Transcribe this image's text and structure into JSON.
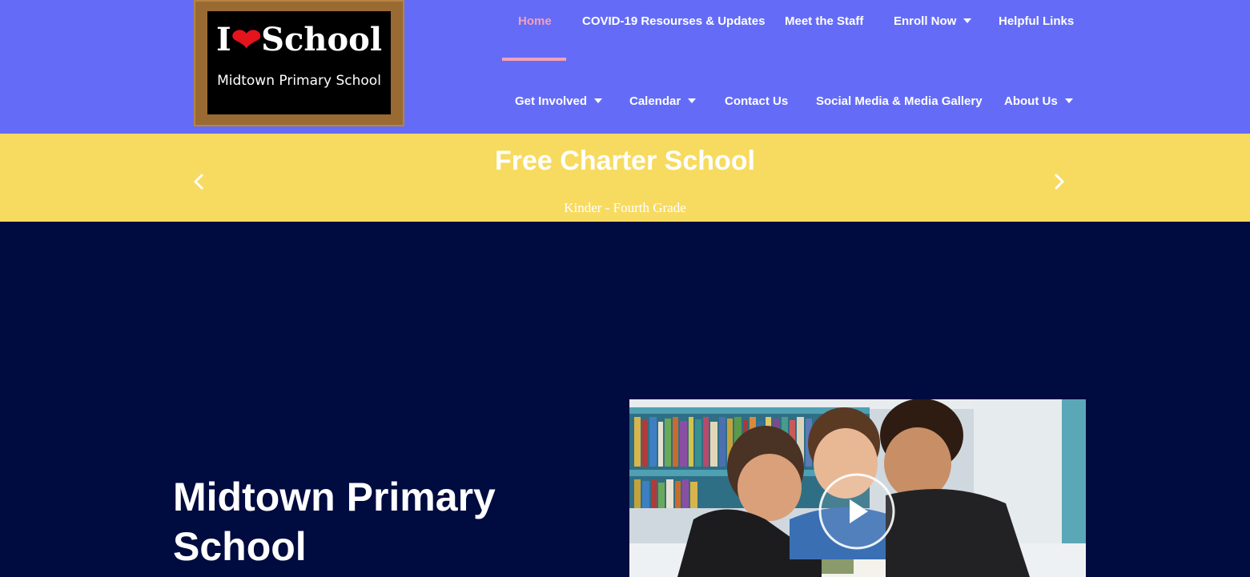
{
  "logo": {
    "line1_a": "I",
    "line1_b": "School",
    "line2": "Midtown Primary School"
  },
  "nav": {
    "row1": [
      {
        "label": "Home",
        "active": true,
        "dropdown": false
      },
      {
        "label": "COVID-19 Resourses & Updates",
        "active": false,
        "dropdown": false
      },
      {
        "label": "Meet the Staff",
        "active": false,
        "dropdown": false
      },
      {
        "label": "Enroll Now",
        "active": false,
        "dropdown": true
      },
      {
        "label": "Helpful Links",
        "active": false,
        "dropdown": false
      }
    ],
    "row2": [
      {
        "label": "Get Involved",
        "dropdown": true
      },
      {
        "label": "Calendar",
        "dropdown": true
      },
      {
        "label": "Contact Us",
        "dropdown": false
      },
      {
        "label": "Social Media & Media Gallery",
        "dropdown": false
      },
      {
        "label": "About Us",
        "dropdown": true
      }
    ]
  },
  "banner": {
    "title": "Free Charter School",
    "subtitle": "Kinder - Fourth Grade"
  },
  "hero": {
    "title": "Midtown Primary School"
  },
  "icons": {
    "prev": "chevron-left-icon",
    "next": "chevron-right-icon",
    "play": "play-icon",
    "heart": "heart-icon",
    "caret": "caret-down-icon"
  },
  "colors": {
    "header_bg": "#646cf7",
    "banner_bg": "#f7db61",
    "page_bg": "#000b3f",
    "active_nav": "#f4a0b8"
  }
}
